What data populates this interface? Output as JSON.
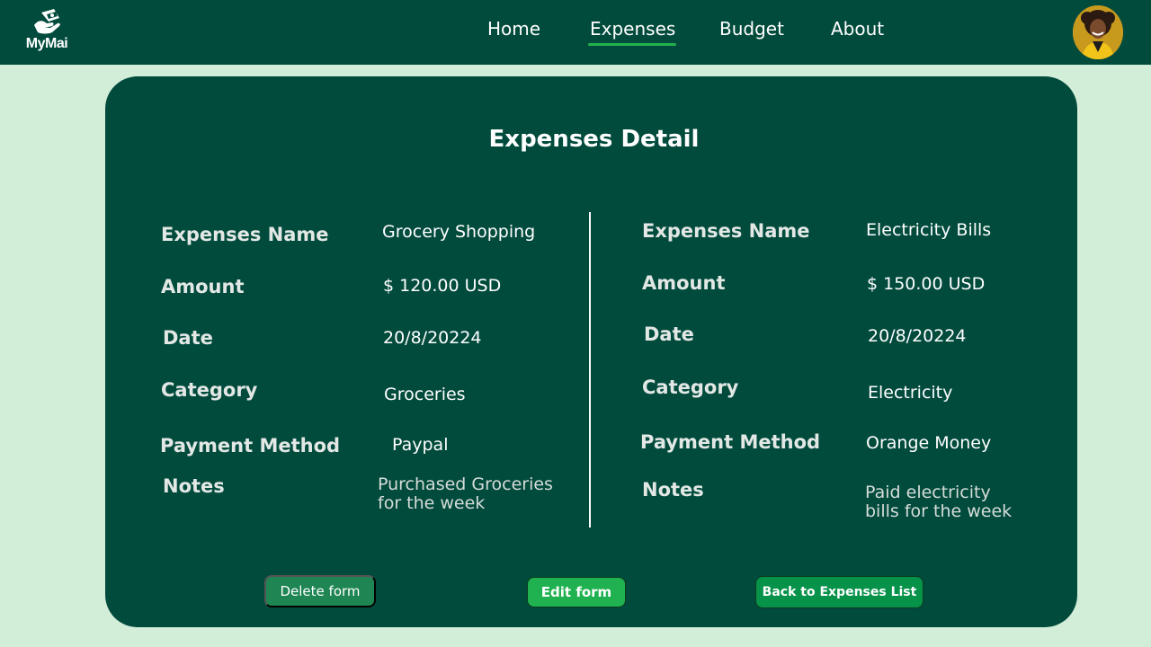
{
  "app": {
    "brand": "MyMai",
    "logo_icon": "money-hand-icon",
    "avatar_icon": "user-avatar"
  },
  "nav": {
    "items": [
      {
        "label": "Home"
      },
      {
        "label": "Expenses",
        "active": true
      },
      {
        "label": "Budget"
      },
      {
        "label": "About"
      }
    ]
  },
  "detail": {
    "title": "Expenses Detail",
    "left": {
      "labels": {
        "name": "Expenses Name",
        "amount": "Amount",
        "date": "Date",
        "category": "Category",
        "payment": "Payment Method",
        "notes": "Notes"
      },
      "values": {
        "name": "Grocery Shopping",
        "amount": "$ 120.00 USD",
        "date": "20/8/20224",
        "category": "Groceries",
        "payment": "Paypal",
        "notes_line1": "Purchased Groceries",
        "notes_line2": "for the week"
      }
    },
    "right": {
      "labels": {
        "name": "Expenses Name",
        "amount": "Amount",
        "date": "Date",
        "category": "Category",
        "payment": "Payment Method",
        "notes": "Notes"
      },
      "values": {
        "name": "Electricity Bills",
        "amount": "$ 150.00 USD",
        "date": "20/8/20224",
        "category": "Electricity",
        "payment": "Orange Money",
        "notes_line1": "Paid electricity",
        "notes_line2": "bills for the week"
      }
    }
  },
  "actions": {
    "delete_label": "Delete form",
    "edit_label": "Edit form",
    "back_label": "Back to Expenses List"
  },
  "colors": {
    "header_bg": "#014b3d",
    "page_bg": "#d3eed8",
    "card_bg": "#014b3d",
    "accent_green": "#21b24c",
    "delete_bg": "#1e8553",
    "edit_bg": "#20b250",
    "back_bg": "#07924a"
  }
}
